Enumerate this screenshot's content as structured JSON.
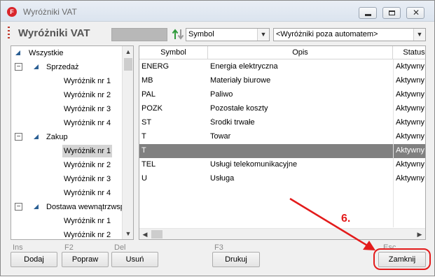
{
  "window": {
    "app_icon_letter": "F",
    "title": "Wyróżniki VAT",
    "controls": [
      "minimize-icon",
      "maximize-icon",
      "close-icon"
    ],
    "close_glyph": "✕"
  },
  "toolbar": {
    "module_title": "Wyróżniki VAT",
    "sort_icon": "sort-arrows-icon",
    "sort_field": "Symbol",
    "filter_value": "<Wyróżniki poza automatem>"
  },
  "tree": {
    "items": [
      {
        "label": "Wszystkie",
        "level": 0,
        "expander": "",
        "triangle": true,
        "selected": false
      },
      {
        "label": "Sprzedaż",
        "level": 1,
        "expander": "−",
        "triangle": true,
        "selected": false
      },
      {
        "label": "Wyróżnik nr 1",
        "level": 2,
        "expander": "",
        "triangle": false,
        "selected": false
      },
      {
        "label": "Wyróżnik nr 2",
        "level": 2,
        "expander": "",
        "triangle": false,
        "selected": false
      },
      {
        "label": "Wyróżnik nr 3",
        "level": 2,
        "expander": "",
        "triangle": false,
        "selected": false
      },
      {
        "label": "Wyróżnik nr 4",
        "level": 2,
        "expander": "",
        "triangle": false,
        "selected": false
      },
      {
        "label": "Zakup",
        "level": 1,
        "expander": "−",
        "triangle": true,
        "selected": false
      },
      {
        "label": "Wyróżnik nr 1",
        "level": 2,
        "expander": "",
        "triangle": false,
        "selected": true
      },
      {
        "label": "Wyróżnik nr 2",
        "level": 2,
        "expander": "",
        "triangle": false,
        "selected": false
      },
      {
        "label": "Wyróżnik nr 3",
        "level": 2,
        "expander": "",
        "triangle": false,
        "selected": false
      },
      {
        "label": "Wyróżnik nr 4",
        "level": 2,
        "expander": "",
        "triangle": false,
        "selected": false
      },
      {
        "label": "Dostawa wewnątrzwsp",
        "level": 1,
        "expander": "−",
        "triangle": true,
        "selected": false
      },
      {
        "label": "Wyróżnik nr 1",
        "level": 2,
        "expander": "",
        "triangle": false,
        "selected": false
      },
      {
        "label": "Wyróżnik nr 2",
        "level": 2,
        "expander": "",
        "triangle": false,
        "selected": false
      }
    ]
  },
  "grid": {
    "columns": [
      "Symbol",
      "Opis",
      "Status"
    ],
    "rows": [
      {
        "symbol": "ENERG",
        "opis": "Energia elektryczna",
        "status": "Aktywny",
        "selected": false
      },
      {
        "symbol": "MB",
        "opis": "Materiały biurowe",
        "status": "Aktywny",
        "selected": false
      },
      {
        "symbol": "PAL",
        "opis": "Paliwo",
        "status": "Aktywny",
        "selected": false
      },
      {
        "symbol": "POZK",
        "opis": "Pozostałe koszty",
        "status": "Aktywny",
        "selected": false
      },
      {
        "symbol": "ST",
        "opis": "Środki trwałe",
        "status": "Aktywny",
        "selected": false
      },
      {
        "symbol": "T",
        "opis": "Towar",
        "status": "Aktywny",
        "selected": false
      },
      {
        "symbol": "T",
        "opis": "",
        "status": "Aktywny",
        "selected": true
      },
      {
        "symbol": "TEL",
        "opis": "Usługi telekomunikacyjne",
        "status": "Aktywny",
        "selected": false
      },
      {
        "symbol": "U",
        "opis": "Usługa",
        "status": "Aktywny",
        "selected": false
      }
    ]
  },
  "scroll": {
    "up": "▲",
    "down": "▼",
    "left": "◀",
    "right": "▶"
  },
  "buttons": {
    "dodaj": {
      "shortcut": "Ins",
      "label": "Dodaj"
    },
    "popraw": {
      "shortcut": "F2",
      "label": "Popraw"
    },
    "usun": {
      "shortcut": "Del",
      "label": "Usuń"
    },
    "drukuj": {
      "shortcut": "F3",
      "label": "Drukuj"
    },
    "zamknij": {
      "shortcut": "Esc",
      "label": "Zamknij"
    }
  },
  "annotation": {
    "step_label": "6.",
    "color": "#e31b1b"
  },
  "colors": {
    "selection_gray": "#808080",
    "tree_selection": "#d4d4d4",
    "accent_red": "#d9262c"
  }
}
